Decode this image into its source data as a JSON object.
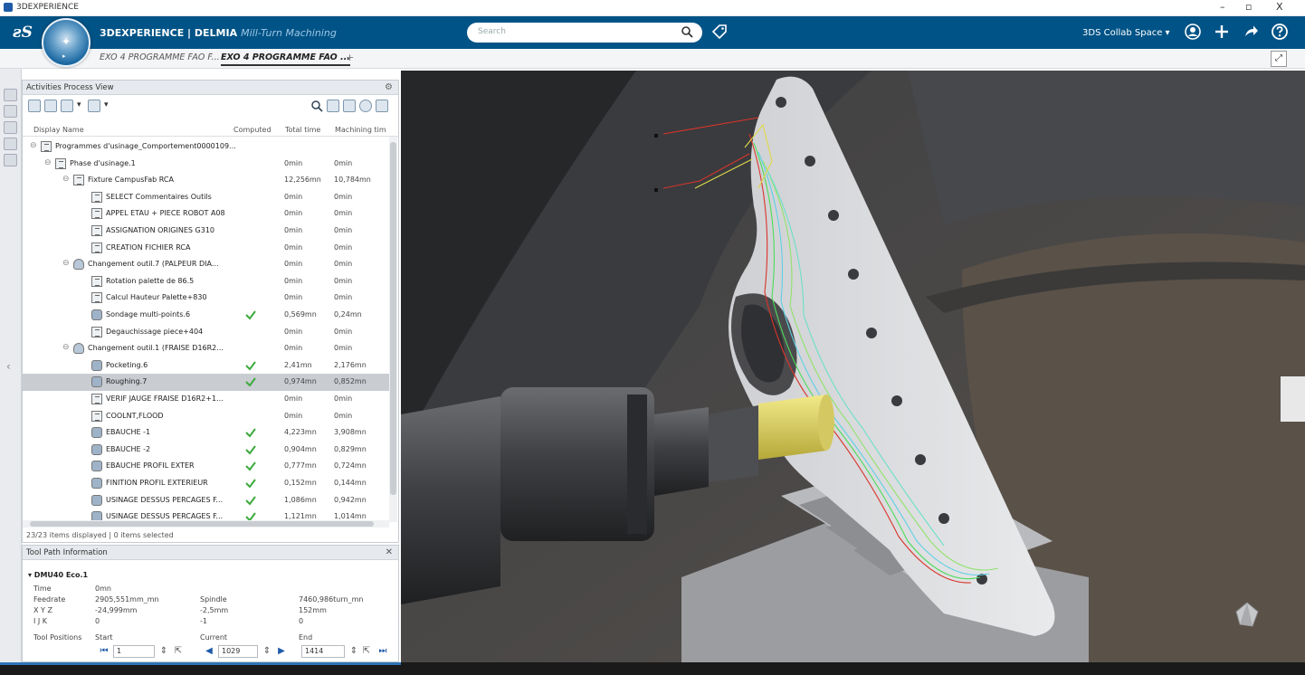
{
  "os": {
    "title": "3DEXPERIENCE",
    "min": "–",
    "max": "▫",
    "close": "X"
  },
  "header": {
    "brand_prefix": "3DEXPERIENCE | DELMIA",
    "app_name": "Mill-Turn Machining",
    "search_placeholder": "Search",
    "collab_space": "3DS Collab Space ▾"
  },
  "tabs": [
    {
      "label": "EXO 4 PROGRAMME FAO F..."
    },
    {
      "label": "EXO 4 PROGRAMME FAO ..."
    }
  ],
  "tab_plus": "+",
  "activities": {
    "title": "Activities Process View",
    "columns": [
      "Display Name",
      "Computed",
      "Total time",
      "Machining tim"
    ],
    "rows": [
      {
        "label": "Programmes d'usinage_Comportement0000109...",
        "tt": "",
        "mt": "",
        "indent": 0,
        "icon": "doc",
        "computed": false
      },
      {
        "label": "Phase d'usinage.1",
        "tt": "0min",
        "mt": "0min",
        "indent": 1,
        "icon": "doc",
        "computed": false
      },
      {
        "label": "Fixture CampusFab RCA",
        "tt": "12,256mn",
        "mt": "10,784mn",
        "indent": 2,
        "icon": "doc",
        "computed": false
      },
      {
        "label": "SELECT Commentaires Outils",
        "tt": "0min",
        "mt": "0min",
        "indent": 3,
        "icon": "doc",
        "computed": false
      },
      {
        "label": "APPEL ETAU + PIECE ROBOT A08",
        "tt": "0min",
        "mt": "0min",
        "indent": 3,
        "icon": "doc",
        "computed": false
      },
      {
        "label": "ASSIGNATION ORIGINES G310",
        "tt": "0min",
        "mt": "0min",
        "indent": 3,
        "icon": "doc",
        "computed": false
      },
      {
        "label": "CREATION FICHIER RCA",
        "tt": "0min",
        "mt": "0min",
        "indent": 3,
        "icon": "doc",
        "computed": false
      },
      {
        "label": "Changement outil.7 (PALPEUR DIA...",
        "tt": "0min",
        "mt": "0min",
        "indent": 2,
        "icon": "tool",
        "computed": false
      },
      {
        "label": "Rotation palette de 86.5",
        "tt": "0min",
        "mt": "0min",
        "indent": 3,
        "icon": "doc",
        "computed": false
      },
      {
        "label": "Calcul Hauteur Palette+830",
        "tt": "0min",
        "mt": "0min",
        "indent": 3,
        "icon": "doc",
        "computed": false
      },
      {
        "label": "Sondage multi-points.6",
        "tt": "0,569mn",
        "mt": "0,24mn",
        "indent": 3,
        "icon": "probe",
        "computed": true
      },
      {
        "label": "Degauchissage piece+404",
        "tt": "0min",
        "mt": "0min",
        "indent": 3,
        "icon": "doc",
        "computed": false
      },
      {
        "label": "Changement outil.1 (FRAISE D16R2...",
        "tt": "0min",
        "mt": "0min",
        "indent": 2,
        "icon": "tool",
        "computed": false
      },
      {
        "label": "Pocketing.6",
        "tt": "2,41mn",
        "mt": "2,176mn",
        "indent": 3,
        "icon": "op",
        "computed": true
      },
      {
        "label": "Roughing.7",
        "tt": "0,974mn",
        "mt": "0,852mn",
        "indent": 3,
        "icon": "op",
        "computed": true,
        "selected": true
      },
      {
        "label": "VERIF JAUGE FRAISE D16R2+1...",
        "tt": "0min",
        "mt": "0min",
        "indent": 3,
        "icon": "doc",
        "computed": false
      },
      {
        "label": "COOLNT,FLOOD",
        "tt": "0min",
        "mt": "0min",
        "indent": 3,
        "icon": "doc",
        "computed": false
      },
      {
        "label": "EBAUCHE -1",
        "tt": "4,223mn",
        "mt": "3,908mn",
        "indent": 3,
        "icon": "op",
        "computed": true
      },
      {
        "label": "EBAUCHE -2",
        "tt": "0,904mn",
        "mt": "0,829mn",
        "indent": 3,
        "icon": "op",
        "computed": true
      },
      {
        "label": "EBAUCHE PROFIL EXTER",
        "tt": "0,777mn",
        "mt": "0,724mn",
        "indent": 3,
        "icon": "op",
        "computed": true
      },
      {
        "label": "FINITION PROFIL EXTERIEUR",
        "tt": "0,152mn",
        "mt": "0,144mn",
        "indent": 3,
        "icon": "op",
        "computed": true
      },
      {
        "label": "USINAGE DESSUS PERCAGES F...",
        "tt": "1,086mn",
        "mt": "0,942mn",
        "indent": 3,
        "icon": "op",
        "computed": true
      },
      {
        "label": "USINAGE DESSUS PERCAGES F...",
        "tt": "1,121mn",
        "mt": "1,014mn",
        "indent": 3,
        "icon": "op",
        "computed": true
      }
    ],
    "status": "23/23 items displayed | 0 items selected"
  },
  "toolpath": {
    "title": "Tool Path Information",
    "head": "▾ DMU40 Eco.1",
    "time_label": "Time",
    "time_val": "0mn",
    "feed_label": "Feedrate",
    "feed_val": "2905,551mm_mn",
    "spindle_label": "Spindle",
    "spindle_val": "7460,986turn_mn",
    "xyz_label": "X Y Z",
    "x_val": "-24,999mm",
    "y_val": "-2,5mm",
    "z_val": "152mm",
    "ijk_label": "I J K",
    "i_val": "0",
    "j_val": "-1",
    "k_val": "0",
    "positions_label": "Tool Positions",
    "start_label": "Start",
    "current_label": "Current",
    "end_label": "End",
    "start_val": "1",
    "current_val": "1029",
    "end_val": "1414"
  },
  "colors": {
    "header": "#005386",
    "accent": "#2d75b6",
    "toolpath_green": "#4ddc5a",
    "toolpath_cyan": "#5fd0e6",
    "toolpath_red": "#d9342b"
  }
}
